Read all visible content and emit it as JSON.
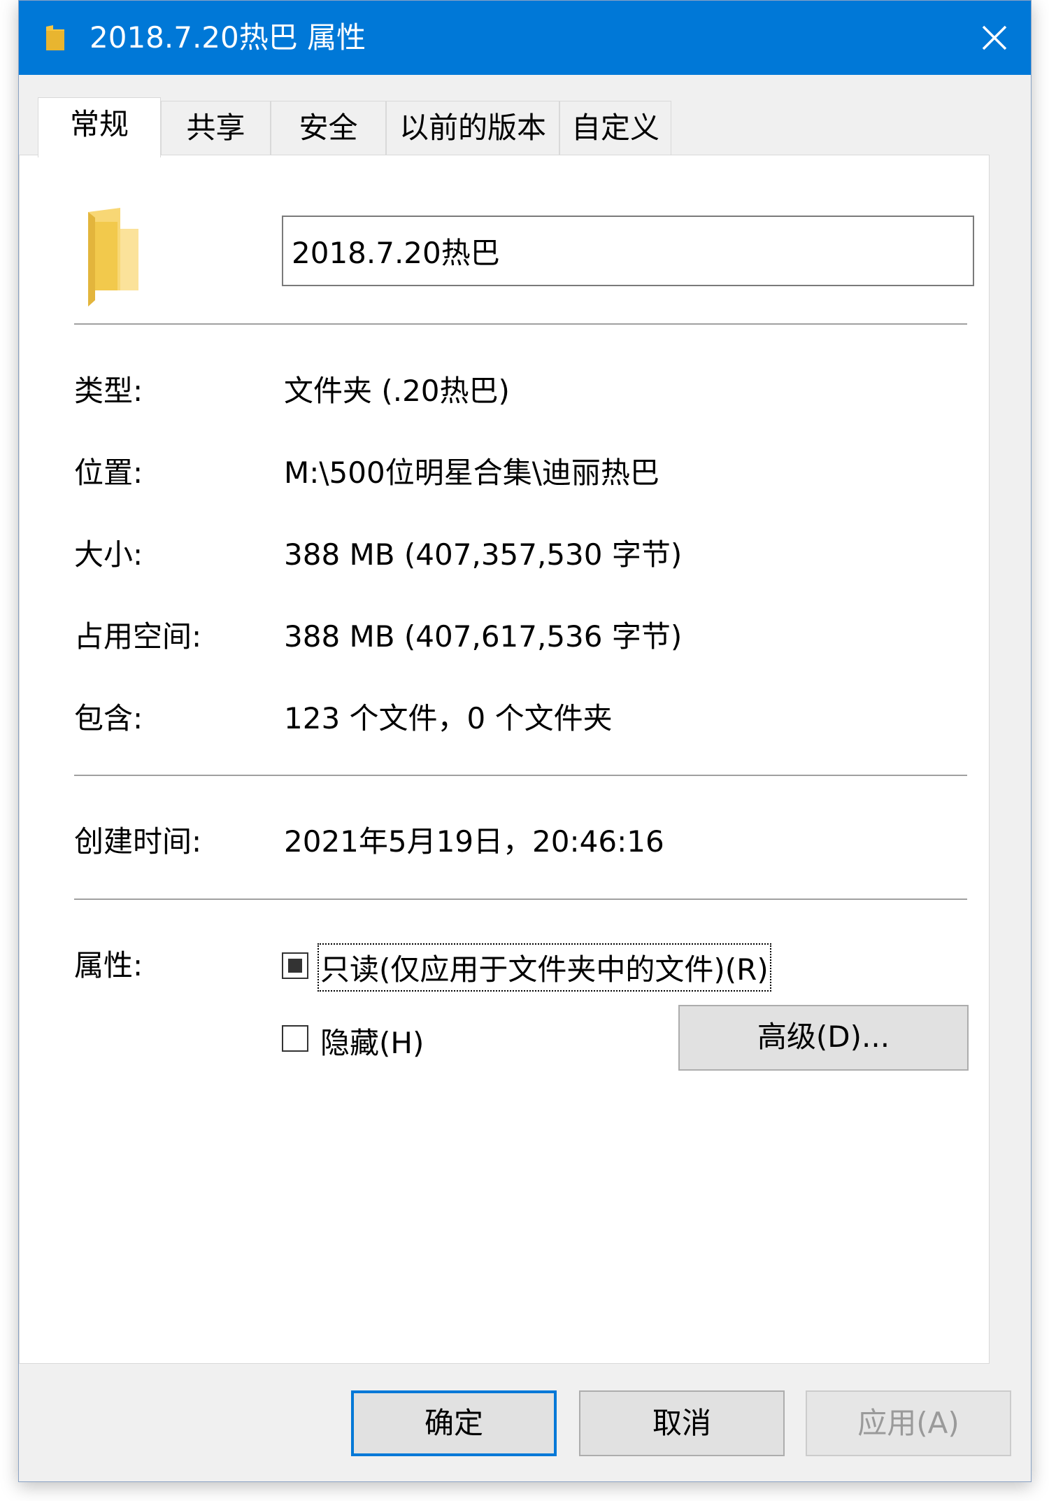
{
  "window": {
    "title": "2018.7.20热巴 属性",
    "close_glyph": "✕",
    "folder_icon": "folder-icon",
    "accent_color": "#0078d7"
  },
  "tabs": [
    {
      "label": "常规",
      "active": true
    },
    {
      "label": "共享",
      "active": false
    },
    {
      "label": "安全",
      "active": false
    },
    {
      "label": "以前的版本",
      "active": false
    },
    {
      "label": "自定义",
      "active": false
    }
  ],
  "general": {
    "folder_name": "2018.7.20热巴",
    "type": {
      "label": "类型:",
      "value": "文件夹 (.20热巴)"
    },
    "location": {
      "label": "位置:",
      "value": "M:\\500位明星合集\\迪丽热巴"
    },
    "size": {
      "label": "大小:",
      "value": "388 MB (407,357,530 字节)"
    },
    "size_on_disk": {
      "label": "占用空间:",
      "value": "388 MB (407,617,536 字节)"
    },
    "contains": {
      "label": "包含:",
      "value": "123 个文件，0 个文件夹"
    },
    "created": {
      "label": "创建时间:",
      "value": "2021年5月19日，20:46:16"
    },
    "attributes": {
      "label": "属性:",
      "readonly": {
        "label": "只读(仅应用于文件夹中的文件)(R)",
        "state": "indeterminate"
      },
      "hidden": {
        "label": "隐藏(H)",
        "state": "unchecked"
      },
      "advanced_button": "高级(D)..."
    }
  },
  "footer": {
    "ok": "确定",
    "cancel": "取消",
    "apply": "应用(A)"
  }
}
